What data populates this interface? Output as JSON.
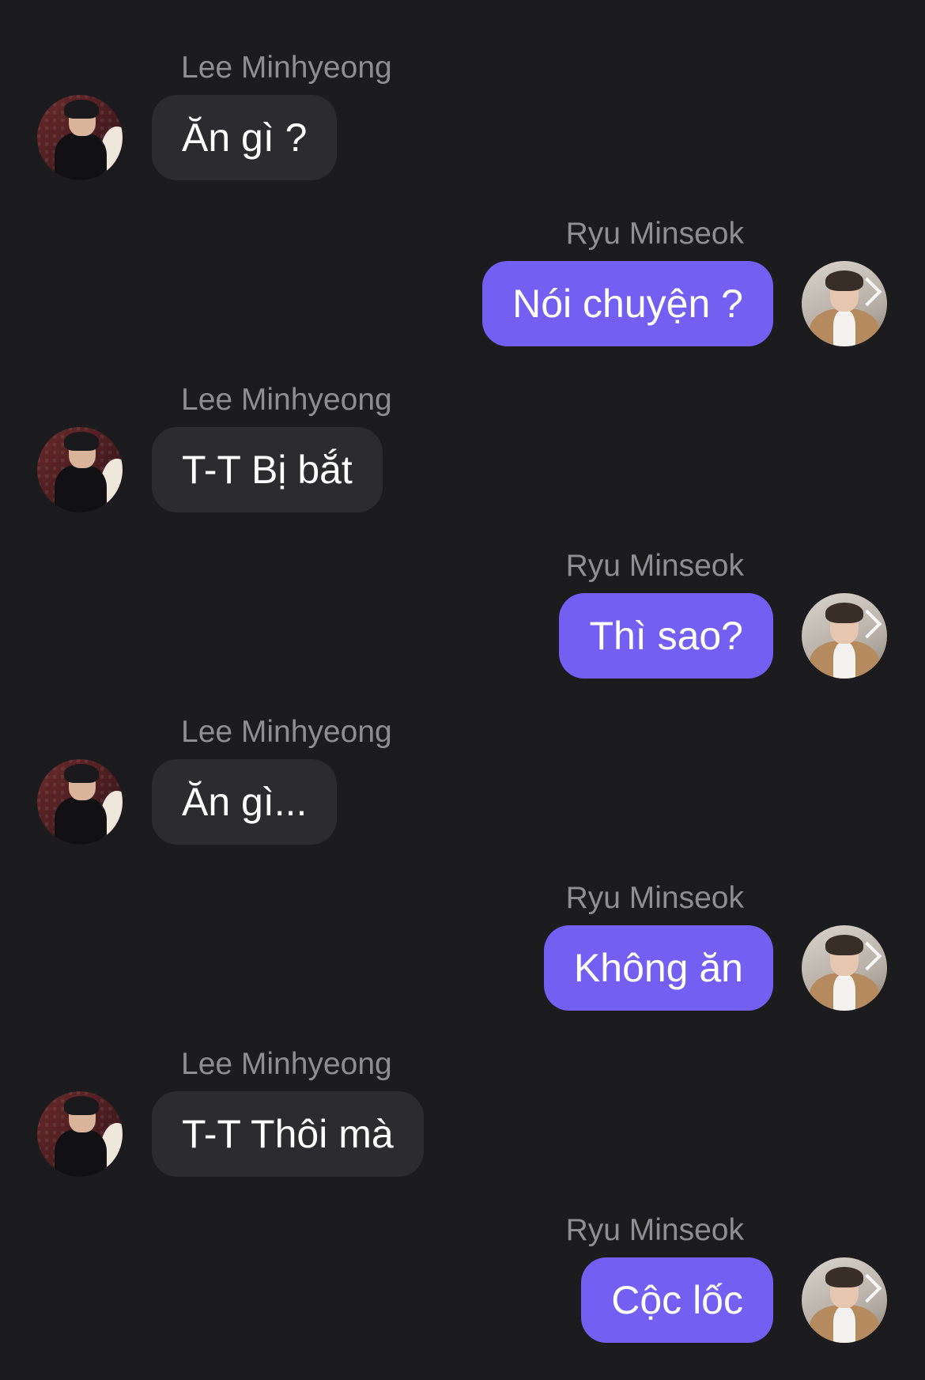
{
  "participants": {
    "left": {
      "name": "Lee Minhyeong",
      "avatar_icon": "profile-photo-lee-minhyeong"
    },
    "right": {
      "name": "Ryu Minseok",
      "avatar_icon": "profile-photo-ryu-minseok"
    }
  },
  "colors": {
    "background": "#1c1c1e",
    "incoming_bubble": "#2c2c2e",
    "outgoing_bubble": "#7360f2",
    "sender_name": "#8e8e93",
    "message_text": "#ffffff"
  },
  "messages": [
    {
      "sender": "Lee Minhyeong",
      "text": "Ăn gì ?"
    },
    {
      "sender": "Ryu Minseok",
      "text": "Nói chuyện ?"
    },
    {
      "sender": "Lee Minhyeong",
      "text": "T-T Bị bắt"
    },
    {
      "sender": "Ryu Minseok",
      "text": "Thì sao?"
    },
    {
      "sender": "Lee Minhyeong",
      "text": "Ăn gì..."
    },
    {
      "sender": "Ryu Minseok",
      "text": "Không ăn"
    },
    {
      "sender": "Lee Minhyeong",
      "text": "T-T Thôi mà"
    },
    {
      "sender": "Ryu Minseok",
      "text": "Cộc lốc"
    }
  ]
}
